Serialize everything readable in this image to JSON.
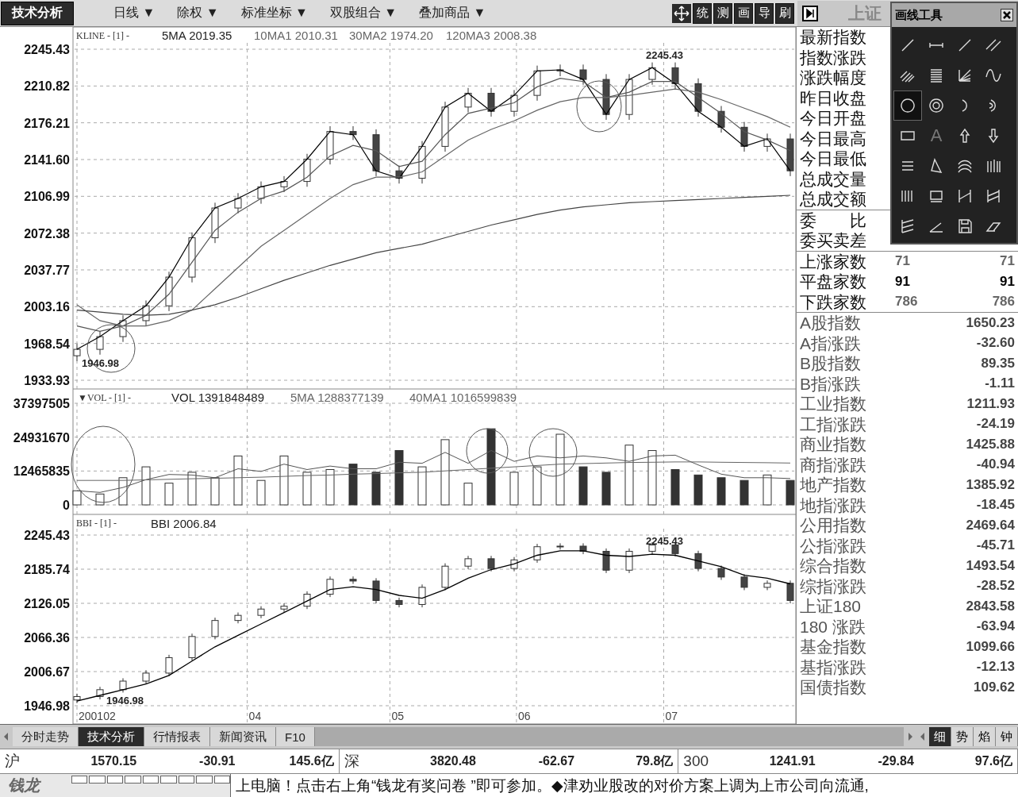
{
  "toolbar": {
    "main_button": "技术分析",
    "menus": [
      "日线 ▼",
      "除权 ▼",
      "标准坐标 ▼",
      "双股组合 ▼",
      "叠加商品 ▼"
    ],
    "tools": [
      "统",
      "测",
      "画",
      "导",
      "刷"
    ],
    "title": "上证"
  },
  "drawing_palette": {
    "title": "画线工具",
    "tools": [
      {
        "selected": false
      },
      {
        "selected": false
      },
      {
        "selected": false
      },
      {
        "selected": false
      },
      {
        "selected": false
      },
      {
        "selected": false
      },
      {
        "selected": false
      },
      {
        "selected": false
      },
      {
        "selected": true
      },
      {
        "selected": false
      },
      {
        "selected": false
      },
      {
        "selected": false
      },
      {
        "selected": false
      },
      {
        "selected": false,
        "label": "A"
      },
      {
        "selected": false
      },
      {
        "selected": false
      },
      {
        "selected": false
      },
      {
        "selected": false
      },
      {
        "selected": false
      },
      {
        "selected": false
      },
      {
        "selected": false
      },
      {
        "selected": false
      },
      {
        "selected": false
      },
      {
        "selected": false
      },
      {
        "selected": false
      },
      {
        "selected": false
      },
      {
        "selected": false
      },
      {
        "selected": false
      }
    ]
  },
  "kline": {
    "header": "KLINE - [1] -",
    "legend_values": [
      "2019.35",
      "2010.31",
      "1974.20",
      "2008.38"
    ],
    "chart_data": {
      "type": "candlestick",
      "grid": true,
      "ylim": [
        1933.93,
        2245.43
      ],
      "yticks": [
        {
          "value": 2245.43,
          "label": "2245.43"
        },
        {
          "value": 2210.82,
          "label": "2210.82"
        },
        {
          "value": 2176.21,
          "label": "2176.21"
        },
        {
          "value": 2141.6,
          "label": "2141.60"
        },
        {
          "value": 2106.99,
          "label": "2106.99"
        },
        {
          "value": 2072.38,
          "label": "2072.38"
        },
        {
          "value": 2037.77,
          "label": "2037.77"
        },
        {
          "value": 2003.16,
          "label": "2003.16"
        },
        {
          "value": 1968.54,
          "label": "1968.54"
        },
        {
          "value": 1933.93,
          "label": "1933.93"
        }
      ],
      "ohlc": [
        [
          1957,
          1968,
          1952,
          1963
        ],
        [
          1963,
          1980,
          1958,
          1975
        ],
        [
          1975,
          1995,
          1970,
          1990
        ],
        [
          1990,
          2009,
          1985,
          2004
        ],
        [
          2004,
          2036,
          1999,
          2031
        ],
        [
          2031,
          2073,
          2026,
          2068
        ],
        [
          2068,
          2101,
          2063,
          2096
        ],
        [
          2096,
          2110,
          2091,
          2105
        ],
        [
          2105,
          2121,
          2100,
          2116
        ],
        [
          2116,
          2126,
          2111,
          2121
        ],
        [
          2121,
          2147,
          2116,
          2142
        ],
        [
          2142,
          2173,
          2137,
          2168
        ],
        [
          2168,
          2173,
          2160,
          2165
        ],
        [
          2165,
          2170,
          2126,
          2131
        ],
        [
          2131,
          2136,
          2119,
          2124
        ],
        [
          2124,
          2159,
          2119,
          2154
        ],
        [
          2154,
          2196,
          2149,
          2191
        ],
        [
          2191,
          2209,
          2186,
          2204
        ],
        [
          2204,
          2209,
          2182,
          2187
        ],
        [
          2187,
          2207,
          2182,
          2202
        ],
        [
          2202,
          2230,
          2197,
          2225
        ],
        [
          2225,
          2231,
          2220,
          2226
        ],
        [
          2226,
          2231,
          2212,
          2217
        ],
        [
          2217,
          2222,
          2179,
          2184
        ],
        [
          2184,
          2222,
          2179,
          2217
        ],
        [
          2217,
          2233,
          2212,
          2228
        ],
        [
          2228,
          2233,
          2208,
          2213
        ],
        [
          2213,
          2218,
          2182,
          2187
        ],
        [
          2187,
          2192,
          2167,
          2172
        ],
        [
          2172,
          2177,
          2149,
          2154
        ],
        [
          2154,
          2166,
          2149,
          2161
        ],
        [
          2161,
          2166,
          2126,
          2131
        ]
      ],
      "series": [
        {
          "name": "5MA",
          "type": "line",
          "color": "#000000",
          "values": [
            1963,
            1975,
            1990,
            2004,
            2031,
            2068,
            2096,
            2105,
            2116,
            2121,
            2142,
            2168,
            2165,
            2131,
            2124,
            2154,
            2191,
            2204,
            2187,
            2202,
            2225,
            2226,
            2217,
            2184,
            2217,
            2228,
            2213,
            2187,
            2172,
            2154,
            2161,
            2131
          ]
        },
        {
          "name": "10MA1",
          "type": "line",
          "color": "#555555",
          "values": [
            1985,
            1980,
            1985,
            1995,
            2015,
            2045,
            2075,
            2092,
            2105,
            2112,
            2125,
            2145,
            2155,
            2150,
            2135,
            2140,
            2165,
            2185,
            2190,
            2195,
            2210,
            2218,
            2215,
            2200,
            2205,
            2215,
            2215,
            2200,
            2185,
            2168,
            2160,
            2150
          ]
        },
        {
          "name": "30MA2",
          "type": "line",
          "color": "#666666",
          "values": [
            2005,
            1990,
            1985,
            1985,
            1990,
            2000,
            2020,
            2040,
            2060,
            2075,
            2090,
            2105,
            2118,
            2125,
            2125,
            2130,
            2145,
            2160,
            2170,
            2178,
            2188,
            2196,
            2200,
            2200,
            2202,
            2205,
            2208,
            2205,
            2198,
            2190,
            2182,
            2172
          ]
        },
        {
          "name": "120MA3",
          "type": "line",
          "color": "#444444",
          "values": [
            2000,
            1998,
            1996,
            1995,
            1996,
            2000,
            2005,
            2012,
            2020,
            2028,
            2035,
            2042,
            2048,
            2054,
            2058,
            2062,
            2068,
            2074,
            2080,
            2085,
            2090,
            2094,
            2097,
            2099,
            2101,
            2102,
            2103,
            2104,
            2105,
            2106,
            2107,
            2108
          ]
        }
      ],
      "annotations": [
        {
          "text": "2245.43"
        },
        {
          "text": "1946.98"
        }
      ]
    }
  },
  "volume": {
    "header": "▼VOL - [1] -",
    "legend_values": [
      "1391848489",
      "1288377139",
      "1016599839"
    ],
    "chart_data": {
      "type": "bar",
      "grid": true,
      "ylim": [
        0,
        37397505
      ],
      "yticks": [
        {
          "value": 37397505,
          "label": "37397505"
        },
        {
          "value": 24931670,
          "label": "24931670"
        },
        {
          "value": 12465835,
          "label": "12465835"
        },
        {
          "value": 0,
          "label": "0"
        }
      ],
      "series": [
        {
          "name": "VOL",
          "type": "bar",
          "color": "#333333",
          "values": [
            5200000,
            4000000,
            10000000,
            14000000,
            8000000,
            12000000,
            10000000,
            18000000,
            9000000,
            18000000,
            12000000,
            13000000,
            15000000,
            12000000,
            20000000,
            14000000,
            24000000,
            8000000,
            28000000,
            12000000,
            14000000,
            26000000,
            14000000,
            12000000,
            22000000,
            20000000,
            13000000,
            11000000,
            10000000,
            9000000,
            11000000,
            9000000
          ]
        },
        {
          "name": "5MA",
          "type": "line",
          "color": "#555555",
          "values": [
            5200000,
            4600000,
            6400000,
            9300000,
            11200000,
            11000000,
            10000000,
            13300000,
            12300000,
            15000000,
            13000000,
            14300000,
            13300000,
            13300000,
            15700000,
            15300000,
            19300000,
            15300000,
            20000000,
            16000000,
            18000000,
            17300000,
            18000000,
            17300000,
            16000000,
            18000000,
            18300000,
            14700000,
            11300000,
            10000000,
            10000000,
            9700000
          ]
        },
        {
          "name": "40MA1",
          "type": "line",
          "color": "#666666",
          "values": [
            9000000,
            9000000,
            9000000,
            9200000,
            9400000,
            9600000,
            9800000,
            10000000,
            10200000,
            10500000,
            10800000,
            11000000,
            11300000,
            11500000,
            11800000,
            12000000,
            12500000,
            13000000,
            13500000,
            14000000,
            14500000,
            15000000,
            15200000,
            15400000,
            15600000,
            15700000,
            15800000,
            15800000,
            15700000,
            15600000,
            15500000,
            15400000
          ]
        }
      ]
    }
  },
  "bbi": {
    "header": "BBI - [1] -",
    "legend_values": [
      "2006.84"
    ],
    "x_labels": [
      "200102",
      "04",
      "05",
      "06",
      "07"
    ],
    "chart_data": {
      "type": "candlestick",
      "grid": true,
      "ylim": [
        1946.98,
        2245.43
      ],
      "yticks": [
        {
          "value": 2245.43,
          "label": "2245.43"
        },
        {
          "value": 2185.74,
          "label": "2185.74"
        },
        {
          "value": 2126.05,
          "label": "2126.05"
        },
        {
          "value": 2066.36,
          "label": "2066.36"
        },
        {
          "value": 2006.67,
          "label": "2006.67"
        },
        {
          "value": 1946.98,
          "label": "1946.98"
        }
      ],
      "ohlc": [
        [
          1957,
          1968,
          1952,
          1963
        ],
        [
          1963,
          1980,
          1958,
          1975
        ],
        [
          1975,
          1995,
          1970,
          1990
        ],
        [
          1990,
          2009,
          1985,
          2004
        ],
        [
          2004,
          2036,
          1999,
          2031
        ],
        [
          2031,
          2073,
          2026,
          2068
        ],
        [
          2068,
          2101,
          2063,
          2096
        ],
        [
          2096,
          2110,
          2091,
          2105
        ],
        [
          2105,
          2121,
          2100,
          2116
        ],
        [
          2116,
          2126,
          2111,
          2121
        ],
        [
          2121,
          2147,
          2116,
          2142
        ],
        [
          2142,
          2173,
          2137,
          2168
        ],
        [
          2168,
          2173,
          2160,
          2165
        ],
        [
          2165,
          2170,
          2126,
          2131
        ],
        [
          2131,
          2136,
          2119,
          2124
        ],
        [
          2124,
          2159,
          2119,
          2154
        ],
        [
          2154,
          2196,
          2149,
          2191
        ],
        [
          2191,
          2209,
          2186,
          2204
        ],
        [
          2204,
          2209,
          2182,
          2187
        ],
        [
          2187,
          2207,
          2182,
          2202
        ],
        [
          2202,
          2230,
          2197,
          2225
        ],
        [
          2225,
          2231,
          2220,
          2226
        ],
        [
          2226,
          2231,
          2212,
          2217
        ],
        [
          2217,
          2222,
          2179,
          2184
        ],
        [
          2184,
          2222,
          2179,
          2217
        ],
        [
          2217,
          2233,
          2212,
          2228
        ],
        [
          2228,
          2233,
          2208,
          2213
        ],
        [
          2213,
          2218,
          2182,
          2187
        ],
        [
          2187,
          2192,
          2167,
          2172
        ],
        [
          2172,
          2177,
          2149,
          2154
        ],
        [
          2154,
          2166,
          2149,
          2161
        ],
        [
          2161,
          2166,
          2126,
          2131
        ]
      ],
      "series": [
        {
          "name": "BBI",
          "type": "line",
          "color": "#000000",
          "values": [
            1955,
            1965,
            1975,
            1985,
            2000,
            2025,
            2050,
            2070,
            2090,
            2110,
            2130,
            2150,
            2155,
            2150,
            2140,
            2135,
            2150,
            2170,
            2185,
            2195,
            2210,
            2218,
            2218,
            2210,
            2208,
            2212,
            2210,
            2200,
            2190,
            2175,
            2170,
            2160
          ]
        }
      ],
      "annotations": [
        {
          "text": "2245.43"
        },
        {
          "text": "1946.98"
        }
      ]
    }
  },
  "quote_fields": [
    "最新指数",
    "指数涨跌",
    "涨跌幅度",
    "昨日收盘",
    "今日开盘",
    "今日最高",
    "今日最低",
    "总成交量",
    "总成交额"
  ],
  "order_fields": [
    "委　　比",
    "委买卖差"
  ],
  "breadth": [
    {
      "label": "上涨家数",
      "value_1": "71",
      "value_2": "71",
      "color": "#666666"
    },
    {
      "label": "平盘家数",
      "value_1": "91",
      "value_2": "91",
      "color": "#000000"
    },
    {
      "label": "下跌家数",
      "value_1": "786",
      "value_2": "786",
      "color": "#666666"
    }
  ],
  "indices": [
    {
      "label": "A股指数",
      "value": "1650.23"
    },
    {
      "label": "A指涨跌",
      "value": "-32.60"
    },
    {
      "label": "B股指数",
      "value": "89.35"
    },
    {
      "label": "B指涨跌",
      "value": "-1.11"
    },
    {
      "label": "工业指数",
      "value": "1211.93"
    },
    {
      "label": "工指涨跌",
      "value": "-24.19"
    },
    {
      "label": "商业指数",
      "value": "1425.88"
    },
    {
      "label": "商指涨跌",
      "value": "-40.94"
    },
    {
      "label": "地产指数",
      "value": "1385.92"
    },
    {
      "label": "地指涨跌",
      "value": "-18.45"
    },
    {
      "label": "公用指数",
      "value": "2469.64"
    },
    {
      "label": "公指涨跌",
      "value": "-45.71"
    },
    {
      "label": "综合指数",
      "value": "1493.54"
    },
    {
      "label": "综指涨跌",
      "value": "-28.52"
    },
    {
      "label": "上证180",
      "value": "2843.58"
    },
    {
      "label": "180 涨跌",
      "value": "-63.94"
    },
    {
      "label": "基金指数",
      "value": "1099.66"
    },
    {
      "label": "基指涨跌",
      "value": "-12.13"
    },
    {
      "label": "国债指数",
      "value": "109.62"
    }
  ],
  "bottom_tabs": [
    {
      "label": "分时走势",
      "selected": false
    },
    {
      "label": "技术分析",
      "selected": true
    },
    {
      "label": "行情报表",
      "selected": false
    },
    {
      "label": "新闻资讯",
      "selected": false
    },
    {
      "label": "F10",
      "selected": false
    }
  ],
  "side_tabs": [
    {
      "label": "细",
      "selected": true
    },
    {
      "label": "势",
      "selected": false
    },
    {
      "label": "焰",
      "selected": false
    },
    {
      "label": "钟",
      "selected": false
    }
  ],
  "status_bar": [
    {
      "market": "沪",
      "index": "1570.15",
      "change": "-30.91",
      "turnover": "145.6亿"
    },
    {
      "market": "深",
      "index": "3820.48",
      "change": "-62.67",
      "turnover": "79.8亿"
    },
    {
      "market": "300",
      "index": "1241.91",
      "change": "-29.84",
      "turnover": "97.6亿"
    }
  ],
  "ticker": {
    "logo": "钱龙",
    "text": "上电脑！点击右上角“钱龙有奖问卷 ”即可参加。◆津劝业股改的对价方案上调为上市公司向流通,"
  }
}
